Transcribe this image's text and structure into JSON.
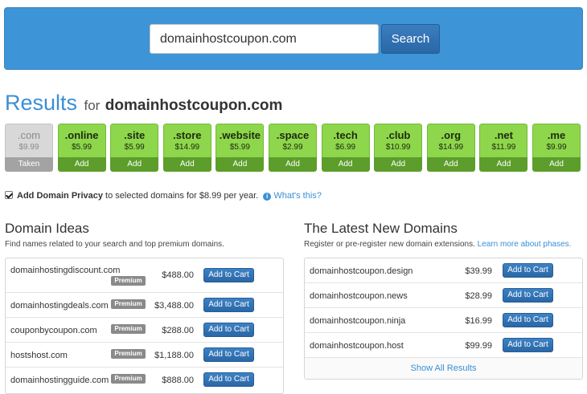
{
  "search": {
    "value": "domainhostcoupon.com",
    "button_label": "Search"
  },
  "results": {
    "heading": "Results",
    "for_label": "for",
    "domain": "domainhostcoupon.com"
  },
  "tlds": [
    {
      "name": ".com",
      "price": "$9.99",
      "action": "Taken",
      "taken": true
    },
    {
      "name": ".online",
      "price": "$5.99",
      "action": "Add",
      "taken": false
    },
    {
      "name": ".site",
      "price": "$5.99",
      "action": "Add",
      "taken": false
    },
    {
      "name": ".store",
      "price": "$14.99",
      "action": "Add",
      "taken": false
    },
    {
      "name": ".website",
      "price": "$5.99",
      "action": "Add",
      "taken": false
    },
    {
      "name": ".space",
      "price": "$2.99",
      "action": "Add",
      "taken": false
    },
    {
      "name": ".tech",
      "price": "$6.99",
      "action": "Add",
      "taken": false
    },
    {
      "name": ".club",
      "price": "$10.99",
      "action": "Add",
      "taken": false
    },
    {
      "name": ".org",
      "price": "$14.99",
      "action": "Add",
      "taken": false
    },
    {
      "name": ".net",
      "price": "$11.99",
      "action": "Add",
      "taken": false
    },
    {
      "name": ".me",
      "price": "$9.99",
      "action": "Add",
      "taken": false
    }
  ],
  "privacy": {
    "checked": true,
    "bold_label": "Add Domain Privacy",
    "text": "to selected domains for $8.99 per year.",
    "info_icon": "info-icon",
    "info_link": "What's this?"
  },
  "ideas": {
    "title": "Domain Ideas",
    "subtitle": "Find names related to your search and top premium domains.",
    "premium_label": "Premium",
    "cart_label": "Add to Cart",
    "rows": [
      {
        "name": "domainhostingdiscount.com",
        "price": "$488.00"
      },
      {
        "name": "domainhostingdeals.com",
        "price": "$3,488.00"
      },
      {
        "name": "couponbycoupon.com",
        "price": "$288.00"
      },
      {
        "name": "hostshost.com",
        "price": "$1,188.00"
      },
      {
        "name": "domainhostingguide.com",
        "price": "$888.00"
      }
    ]
  },
  "latest": {
    "title": "The Latest New Domains",
    "subtitle": "Register or pre-register new domain extensions.",
    "learn_link": "Learn more about phases.",
    "cart_label": "Add to Cart",
    "rows": [
      {
        "name": "domainhostcoupon.design",
        "price": "$39.99"
      },
      {
        "name": "domainhostcoupon.news",
        "price": "$28.99"
      },
      {
        "name": "domainhostcoupon.ninja",
        "price": "$16.99"
      },
      {
        "name": "domainhostcoupon.host",
        "price": "$99.99"
      }
    ],
    "show_all": "Show All Results"
  },
  "colors": {
    "banner": "#3d94d6",
    "accent": "#3a8fd4",
    "available": "#8ed64b",
    "taken": "#d8d8d8"
  }
}
